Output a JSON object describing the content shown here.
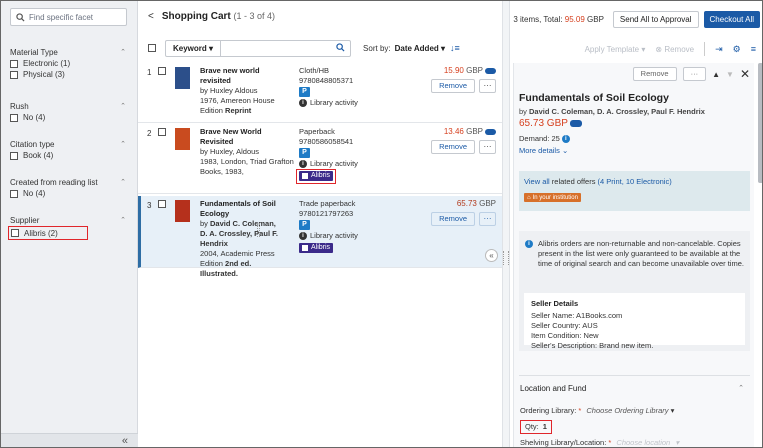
{
  "facets": {
    "search_placeholder": "Find specific facet",
    "groups": [
      {
        "title": "Material Type",
        "options": [
          "Electronic (1)",
          "Physical (3)"
        ]
      },
      {
        "title": "Rush",
        "options": [
          "No (4)"
        ]
      },
      {
        "title": "Citation type",
        "options": [
          "Book (4)"
        ]
      },
      {
        "title": "Created from reading list",
        "options": [
          "No (4)"
        ]
      },
      {
        "title": "Supplier",
        "options": [
          "Alibris (2)"
        ]
      }
    ],
    "collapse_glyph": "«"
  },
  "cart": {
    "title": "Shopping Cart",
    "count": "(1 - 3 of 4)",
    "keyword_label": "Keyword",
    "sort_label": "Sort by:",
    "sort_value": "Date Added",
    "items": [
      {
        "num": "1",
        "title": "Brave new world revisited",
        "by": "by Huxley Aldous",
        "pub": "1976, Amereon House",
        "edition_pre": "Edition ",
        "edition": "Reprint",
        "format": "Cloth/HB",
        "isbn": "9780848805371",
        "badge": "P",
        "activity": "Library activity",
        "price": "15.90",
        "currency": "GBP",
        "remove": "Remove",
        "more": "···",
        "cover_color": "#2c4f8a"
      },
      {
        "num": "2",
        "title": "Brave New World Revisited",
        "by": "by Huxley, Aldous",
        "pub": "1983, London, Triad Grafton",
        "pub2": "Books, 1983,",
        "format": "Paperback",
        "isbn": "9780586058541",
        "badge": "P",
        "activity": "Library activity",
        "supplier": "Alibris",
        "price": "13.46",
        "currency": "GBP",
        "remove": "Remove",
        "more": "···",
        "cover_color": "#c94b1f"
      },
      {
        "num": "3",
        "title": "Fundamentals of Soil Ecology",
        "by_pre": "by ",
        "by": "David C. Coleman, D. A. Crossley, Paul F. Hendrix",
        "pub": "2004, Academic Press",
        "edition_pre": "Edition ",
        "edition": "2nd ed. Illustrated.",
        "format": "Trade paperback",
        "isbn": "9780121797263",
        "badge": "P",
        "activity": "Library activity",
        "supplier": "Alibris",
        "price": "65.73",
        "currency": "GBP",
        "remove": "Remove",
        "more": "···",
        "cover_color": "#b5301c"
      }
    ]
  },
  "summary": {
    "total_pre": "3 items, Total: ",
    "total_amount": "95.09",
    "total_cur": " GBP",
    "send_approval": "Send All to Approval",
    "checkout": "Checkout All"
  },
  "right_toolbar": {
    "apply_template": "Apply Template",
    "remove": "Remove"
  },
  "detail": {
    "remove": "Remove",
    "more": "···",
    "title": "Fundamentals of Soil Ecology",
    "authors_pre": "by ",
    "authors": "David C. Coleman, D. A. Crossley, Paul F. Hendrix",
    "price": "65.73 GBP",
    "demand": "Demand: 25",
    "more_details": "More details",
    "offers_view": "View all",
    "offers_text": " related offers ",
    "offers_counts": "(4 Print, 10 Electronic)",
    "institution": "In your institution",
    "notice": "Alibris orders are non-returnable and non-cancelable. Copies present in the list were only guaranteed to be available at the time of original search and can become unavailable over time.",
    "seller_title": "Seller Details",
    "seller_name": "Seller Name: A1Books.com",
    "seller_country": "Seller Country: AUS",
    "item_condition": "Item Condition: New",
    "seller_desc": "Seller's Description: Brand new item.",
    "location_fund": "Location and Fund",
    "ordering_library_label": "Ordering Library:",
    "ordering_library_value": "Choose Ordering Library",
    "qty_label": "Qty:",
    "qty_value": "1",
    "shelving_label": "Shelving Library/Location:",
    "shelving_value": "Choose location",
    "required": "*"
  },
  "colors": {
    "accent": "#1b5aa6",
    "price": "#d6401f",
    "highlight": "#e0262b",
    "supplier_badge": "#3b2a8a",
    "institution_badge": "#d7702a"
  }
}
